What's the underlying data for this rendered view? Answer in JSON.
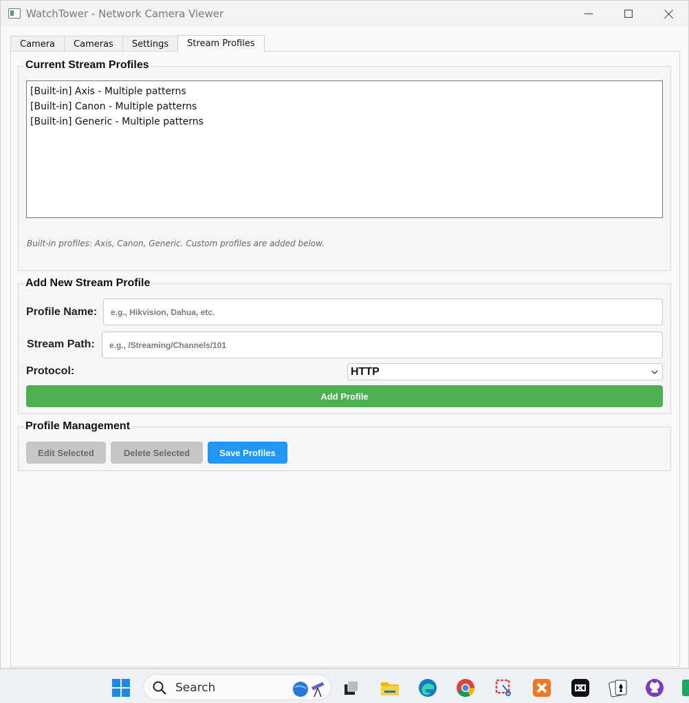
{
  "window": {
    "title": "WatchTower - Network Camera Viewer"
  },
  "tabs": [
    {
      "label": "Camera"
    },
    {
      "label": "Cameras"
    },
    {
      "label": "Settings"
    },
    {
      "label": "Stream Profiles",
      "active": true
    }
  ],
  "current_profiles": {
    "title": "Current Stream Profiles",
    "items": [
      "[Built-in] Axis - Multiple patterns",
      "[Built-in] Canon - Multiple patterns",
      "[Built-in] Generic - Multiple patterns"
    ],
    "hint": "Built-in profiles: Axis, Canon, Generic. Custom profiles are added below."
  },
  "add_profile": {
    "title": "Add New Stream Profile",
    "name_label": "Profile Name:",
    "name_placeholder": "e.g., Hikvision, Dahua, etc.",
    "path_label": "Stream Path:",
    "path_placeholder": "e.g., /Streaming/Channels/101",
    "protocol_label": "Protocol:",
    "protocol_value": "HTTP",
    "add_button": "Add Profile"
  },
  "management": {
    "title": "Profile Management",
    "edit_button": "Edit Selected",
    "delete_button": "Delete Selected",
    "save_button": "Save Profiles"
  },
  "taskbar": {
    "search_label": "Search"
  },
  "colors": {
    "add_button": "#4caf50",
    "save_button": "#2196f3",
    "disabled_button": "#c6c6c6"
  }
}
